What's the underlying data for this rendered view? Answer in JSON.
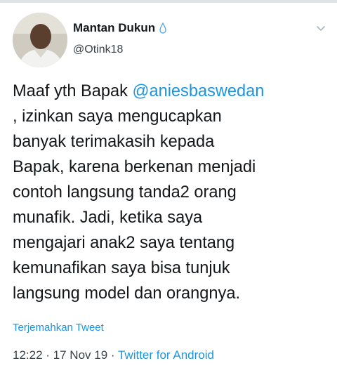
{
  "header": {
    "display_name": "Mantan Dukun",
    "handle": "@Otink18",
    "verified_icon": "water-drop-icon",
    "menu_icon": "chevron-down-icon",
    "avatar_icon": "avatar"
  },
  "tweet": {
    "lines": [
      {
        "pre": "Maaf yth Bapak ",
        "mention": "@aniesbaswedan"
      },
      {
        "text": ", izinkan saya mengucapkan"
      },
      {
        "text": "banyak terimakasih kepada"
      },
      {
        "text": "Bapak, karena berkenan menjadi"
      },
      {
        "text": "contoh langsung tanda2 orang"
      },
      {
        "text": "munafik. Jadi, ketika saya"
      },
      {
        "text": "mengajari anak2 saya tentang"
      },
      {
        "text": "kemunafikan saya bisa tunjuk"
      },
      {
        "text": "langsung model dan orangnya."
      }
    ]
  },
  "translate_label": "Terjemahkan Tweet",
  "meta": {
    "time": "12:22",
    "separator": " · ",
    "date": "17 Nov 19",
    "source": "Twitter for Android"
  },
  "colors": {
    "link": "#1b95e0",
    "text": "#14171a",
    "secondary": "#3b4248"
  }
}
